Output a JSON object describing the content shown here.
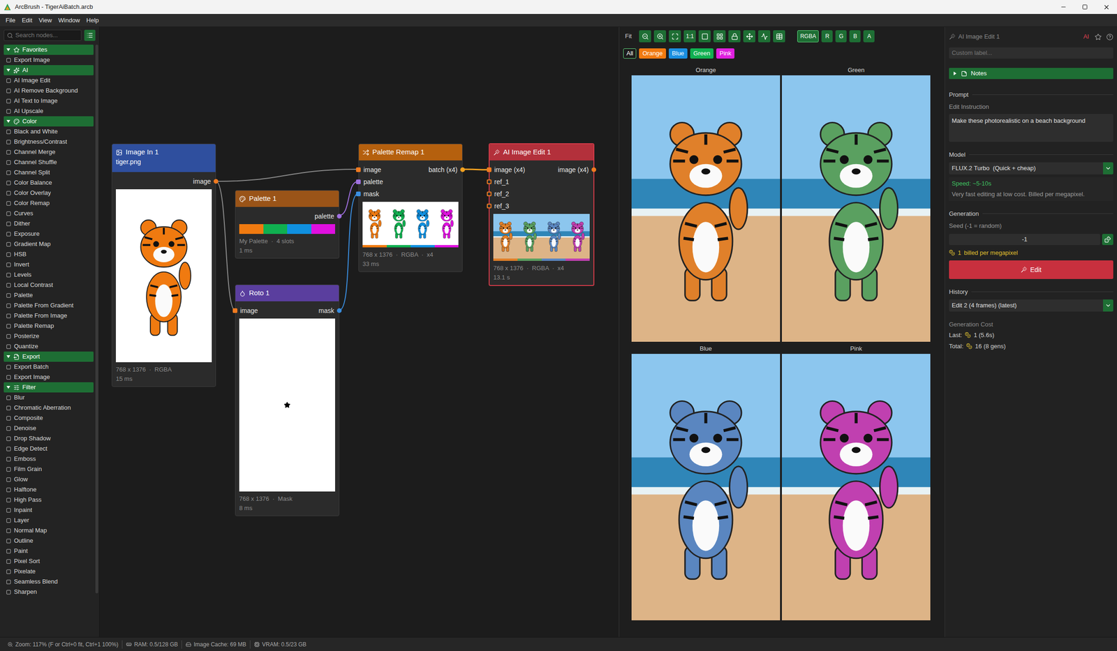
{
  "window": {
    "title": "ArcBrush - TigerAiBatch.arcb"
  },
  "menu": [
    "File",
    "Edit",
    "View",
    "Window",
    "Help"
  ],
  "sidebar": {
    "search_placeholder": "Search nodes...",
    "groups": [
      {
        "label": "Favorites",
        "expanded": true,
        "items": [
          "Export Image"
        ]
      },
      {
        "label": "AI",
        "expanded": true,
        "items": [
          "AI Image Edit",
          "AI Remove Background",
          "AI Text to Image",
          "AI Upscale"
        ]
      },
      {
        "label": "Color",
        "expanded": true,
        "items": [
          "Black and White",
          "Brightness/Contrast",
          "Channel Merge",
          "Channel Shuffle",
          "Channel Split",
          "Color Balance",
          "Color Overlay",
          "Color Remap",
          "Curves",
          "Dither",
          "Exposure",
          "Gradient Map",
          "HSB",
          "Invert",
          "Levels",
          "Local Contrast",
          "Palette",
          "Palette From Gradient",
          "Palette From Image",
          "Palette Remap",
          "Posterize",
          "Quantize"
        ]
      },
      {
        "label": "Export",
        "expanded": true,
        "items": [
          "Export Batch",
          "Export Image"
        ]
      },
      {
        "label": "Filter",
        "expanded": true,
        "items": [
          "Blur",
          "Chromatic Aberration",
          "Composite",
          "Denoise",
          "Drop Shadow",
          "Edge Detect",
          "Emboss",
          "Film Grain",
          "Glow",
          "Halftone",
          "High Pass",
          "Inpaint",
          "Layer",
          "Normal Map",
          "Outline",
          "Paint",
          "Pixel Sort",
          "Pixelate",
          "Seamless Blend",
          "Sharpen"
        ]
      }
    ]
  },
  "nodes": [
    {
      "title": "Image In 1",
      "subtitle": "tiger.png",
      "color": "#2f4f9e",
      "selected": false,
      "inputs": [],
      "outputs": [
        {
          "label": "image",
          "color": "#f07a20",
          "connected": true
        }
      ],
      "preview": {
        "kind": "single",
        "colors": [
          "#f07a10"
        ]
      },
      "meta": "768 x 1376  ·  RGBA",
      "time": "15 ms"
    },
    {
      "title": "Palette 1",
      "subtitle": "",
      "color": "#9a5418",
      "selected": false,
      "inputs": [],
      "outputs": [
        {
          "label": "palette",
          "color": "#a070e0",
          "connected": true
        }
      ],
      "preview": {
        "kind": "swatches",
        "colors": [
          "#f07a10",
          "#10b050",
          "#1090e0",
          "#e010e0"
        ]
      },
      "meta": "My Palette  ·  4 slots",
      "time": "1 ms"
    },
    {
      "title": "Roto 1",
      "subtitle": "",
      "color": "#5a3e9e",
      "selected": false,
      "inputs": [
        {
          "label": "image",
          "color": "#f07a20",
          "connected": true
        }
      ],
      "outputs": [
        {
          "label": "mask",
          "color": "#3a8ee0",
          "connected": true
        }
      ],
      "preview": {
        "kind": "mask",
        "colors": []
      },
      "meta": "768 x 1376  ·  Mask",
      "time": "8 ms"
    },
    {
      "title": "Palette Remap 1",
      "subtitle": "",
      "color": "#b5600e",
      "selected": false,
      "inputs": [
        {
          "label": "image",
          "color": "#f07a20",
          "connected": true
        },
        {
          "label": "palette",
          "color": "#a070e0",
          "connected": true
        },
        {
          "label": "mask",
          "color": "#3a8ee0",
          "connected": true
        }
      ],
      "outputs": [
        {
          "label": "batch (x4)",
          "color": "#f0a020",
          "connected": true
        }
      ],
      "preview": {
        "kind": "batch",
        "colors": [
          "#f07a10",
          "#10b050",
          "#1090e0",
          "#e010e0"
        ]
      },
      "meta": "768 x 1376  ·  RGBA  ·  x4",
      "time": "33 ms"
    },
    {
      "title": "AI Image Edit 1",
      "subtitle": "",
      "color": "#b3303b",
      "selected": true,
      "inputs": [
        {
          "label": "image (x4)",
          "color": "#f07a20",
          "connected": true
        },
        {
          "label": "ref_1",
          "color": "#f07a20",
          "connected": false
        },
        {
          "label": "ref_2",
          "color": "#f07a20",
          "connected": false
        },
        {
          "label": "ref_3",
          "color": "#f07a20",
          "connected": false
        }
      ],
      "outputs": [
        {
          "label": "image (x4)",
          "color": "#f07a20",
          "connected": true
        }
      ],
      "preview": {
        "kind": "beach-batch",
        "colors": [
          "#e0802a",
          "#5aa060",
          "#5a86c0",
          "#c040b0"
        ]
      },
      "meta": "768 x 1376  ·  RGBA  ·  x4",
      "time": "13.1 s"
    }
  ],
  "viewer": {
    "fit_label": "Fit",
    "tools": [
      {
        "kind": "icon",
        "label": ""
      },
      {
        "kind": "icon",
        "label": ""
      },
      {
        "kind": "icon",
        "label": ""
      },
      {
        "kind": "text",
        "label": "1:1"
      },
      {
        "kind": "icon",
        "label": ""
      },
      {
        "kind": "icon",
        "label": ""
      },
      {
        "kind": "icon",
        "label": ""
      },
      {
        "kind": "icon",
        "label": ""
      },
      {
        "kind": "icon",
        "label": ""
      },
      {
        "kind": "icon",
        "label": ""
      }
    ],
    "channels": [
      {
        "label": "RGBA",
        "selected": true
      },
      {
        "label": "R",
        "selected": false
      },
      {
        "label": "G",
        "selected": false
      },
      {
        "label": "B",
        "selected": false
      },
      {
        "label": "A",
        "selected": false
      }
    ],
    "filters": [
      {
        "label": "All",
        "selected": true,
        "color": "#1b1b1b"
      },
      {
        "label": "Orange",
        "selected": false,
        "color": "#f07a10"
      },
      {
        "label": "Blue",
        "selected": false,
        "color": "#1a8fe0"
      },
      {
        "label": "Green",
        "selected": false,
        "color": "#10b050"
      },
      {
        "label": "Pink",
        "selected": false,
        "color": "#e020e0"
      }
    ],
    "frames": [
      {
        "label": "Orange",
        "color": "#e0802a"
      },
      {
        "label": "Green",
        "color": "#5aa060"
      },
      {
        "label": "Blue",
        "color": "#5a86c0"
      },
      {
        "label": "Pink",
        "color": "#c040b0"
      }
    ]
  },
  "inspector": {
    "node_label": "AI Image Edit 1",
    "badge": "AI",
    "label_placeholder": "Custom label...",
    "notes": {
      "label": "Notes",
      "expanded": false
    },
    "prompt": {
      "section": "Prompt",
      "field_label": "Edit Instruction",
      "value": "Make these photorealistic on a beach background"
    },
    "model": {
      "section": "Model",
      "value": "FLUX.2 Turbo  (Quick + cheap)",
      "speed": "Speed: ~5-10s",
      "description": "Very fast editing at low cost. Billed per megapixel."
    },
    "generation": {
      "section": "Generation",
      "seed_label": "Seed (-1 = random)",
      "seed": "-1",
      "cost_count": "1",
      "cost_note": "billed per megapixel",
      "button": "Edit"
    },
    "history": {
      "section": "History",
      "value": "Edit 2 (4 frames) (latest)"
    },
    "cost": {
      "section": "Generation Cost",
      "rows": [
        {
          "label": "Last:",
          "value": "1 (5.6s)"
        },
        {
          "label": "Total:",
          "value": "16 (8 gens)"
        }
      ]
    }
  },
  "status_bar": [
    "Zoom: 117% (F or Ctrl+0 fit, Ctrl+1 100%)",
    "RAM: 0.5/128 GB",
    "Image Cache: 69 MB",
    "VRAM: 0.5/23 GB"
  ]
}
